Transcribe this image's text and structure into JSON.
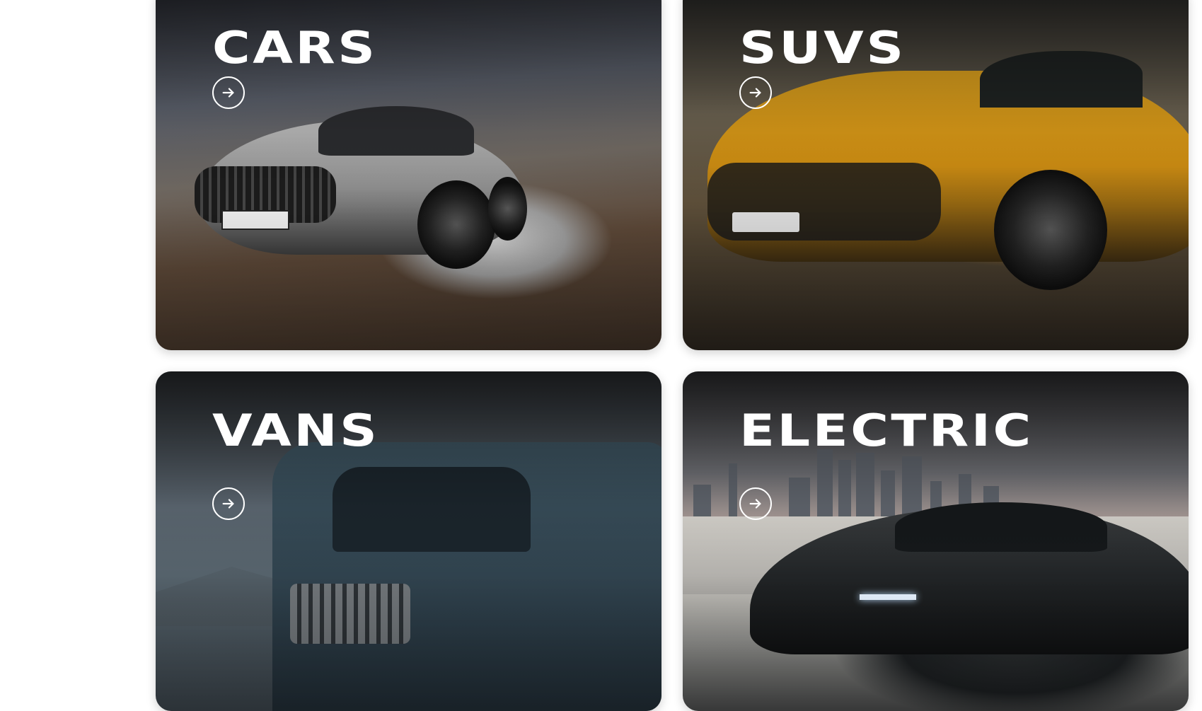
{
  "categories": [
    {
      "id": "cars",
      "title": "CARS",
      "icon": "arrow-right-icon"
    },
    {
      "id": "suvs",
      "title": "SUVS",
      "icon": "arrow-right-icon"
    },
    {
      "id": "vans",
      "title": "VANS",
      "icon": "arrow-right-icon"
    },
    {
      "id": "electric",
      "title": "ELECTRIC",
      "icon": "arrow-right-icon"
    }
  ],
  "colors": {
    "card_text": "#ffffff",
    "page_background": "#ffffff"
  }
}
